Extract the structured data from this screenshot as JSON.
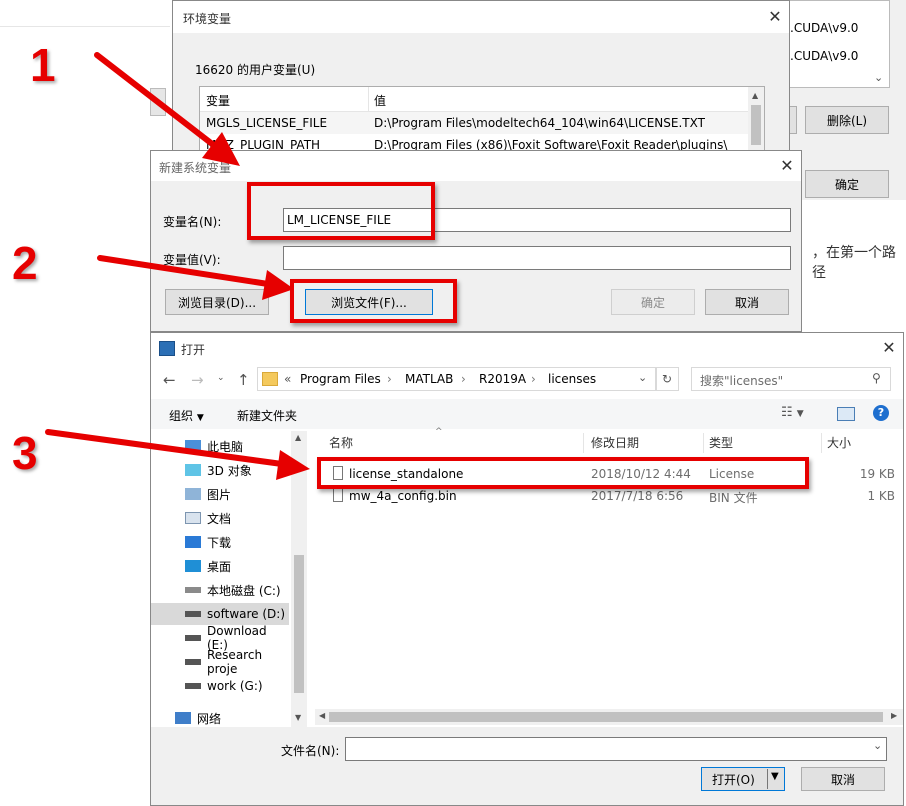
{
  "env_dialog": {
    "title": "环境变量",
    "group_label": "16620 的用户变量(U)",
    "col_var": "变量",
    "col_val": "值",
    "rows": [
      {
        "name": "MGLS_LICENSE_FILE",
        "value": "D:\\Program Files\\modeltech64_104\\win64\\LICENSE.TXT"
      },
      {
        "name": "MOZ_PLUGIN_PATH",
        "value": "D:\\Program Files (x86)\\Foxit Software\\Foxit Reader\\plugins\\"
      }
    ]
  },
  "bg_right": {
    "line1": ".CUDA\\v9.0",
    "line2": ".CUDA\\v9.0",
    "delete_btn": "删除(L)",
    "confirm_btn": "确定",
    "page_text": "，在第一个路径"
  },
  "new_var_dialog": {
    "title": "新建系统变量",
    "name_label": "变量名(N):",
    "name_value": "LM_LICENSE_FILE",
    "value_label": "变量值(V):",
    "value_value": "",
    "browse_dir": "浏览目录(D)...",
    "browse_file": "浏览文件(F)...",
    "ok": "确定",
    "cancel": "取消"
  },
  "open_dialog": {
    "title": "打开",
    "breadcrumb": [
      "«",
      "Program Files",
      "MATLAB",
      "R2019A",
      "licenses"
    ],
    "search_placeholder": "搜索\"licenses\"",
    "organize": "组织",
    "new_folder": "新建文件夹",
    "sidebar": [
      {
        "label": "此电脑",
        "icon": "computer-icon"
      },
      {
        "label": "3D 对象",
        "icon": "3d-objects-icon"
      },
      {
        "label": "图片",
        "icon": "pictures-icon"
      },
      {
        "label": "文档",
        "icon": "documents-icon"
      },
      {
        "label": "下载",
        "icon": "downloads-icon"
      },
      {
        "label": "桌面",
        "icon": "desktop-icon"
      },
      {
        "label": "本地磁盘 (C:)",
        "icon": "drive-icon"
      },
      {
        "label": "software (D:)",
        "icon": "drive-icon"
      },
      {
        "label": "Download (E:)",
        "icon": "drive-icon"
      },
      {
        "label": "Research proje",
        "icon": "drive-icon"
      },
      {
        "label": "work (G:)",
        "icon": "drive-icon"
      },
      {
        "label": "网络",
        "icon": "network-icon"
      }
    ],
    "columns": [
      "名称",
      "修改日期",
      "类型",
      "大小"
    ],
    "files": [
      {
        "name": "license_standalone",
        "date": "2018/10/12 4:44",
        "type": "License",
        "size": "19 KB"
      },
      {
        "name": "mw_4a_config.bin",
        "date": "2017/7/18 6:56",
        "type": "BIN 文件",
        "size": "1 KB"
      }
    ],
    "filename_label": "文件名(N):",
    "filename_value": "",
    "open_btn": "打开(O)",
    "cancel_btn": "取消"
  },
  "annotations": [
    "1",
    "2",
    "3"
  ]
}
